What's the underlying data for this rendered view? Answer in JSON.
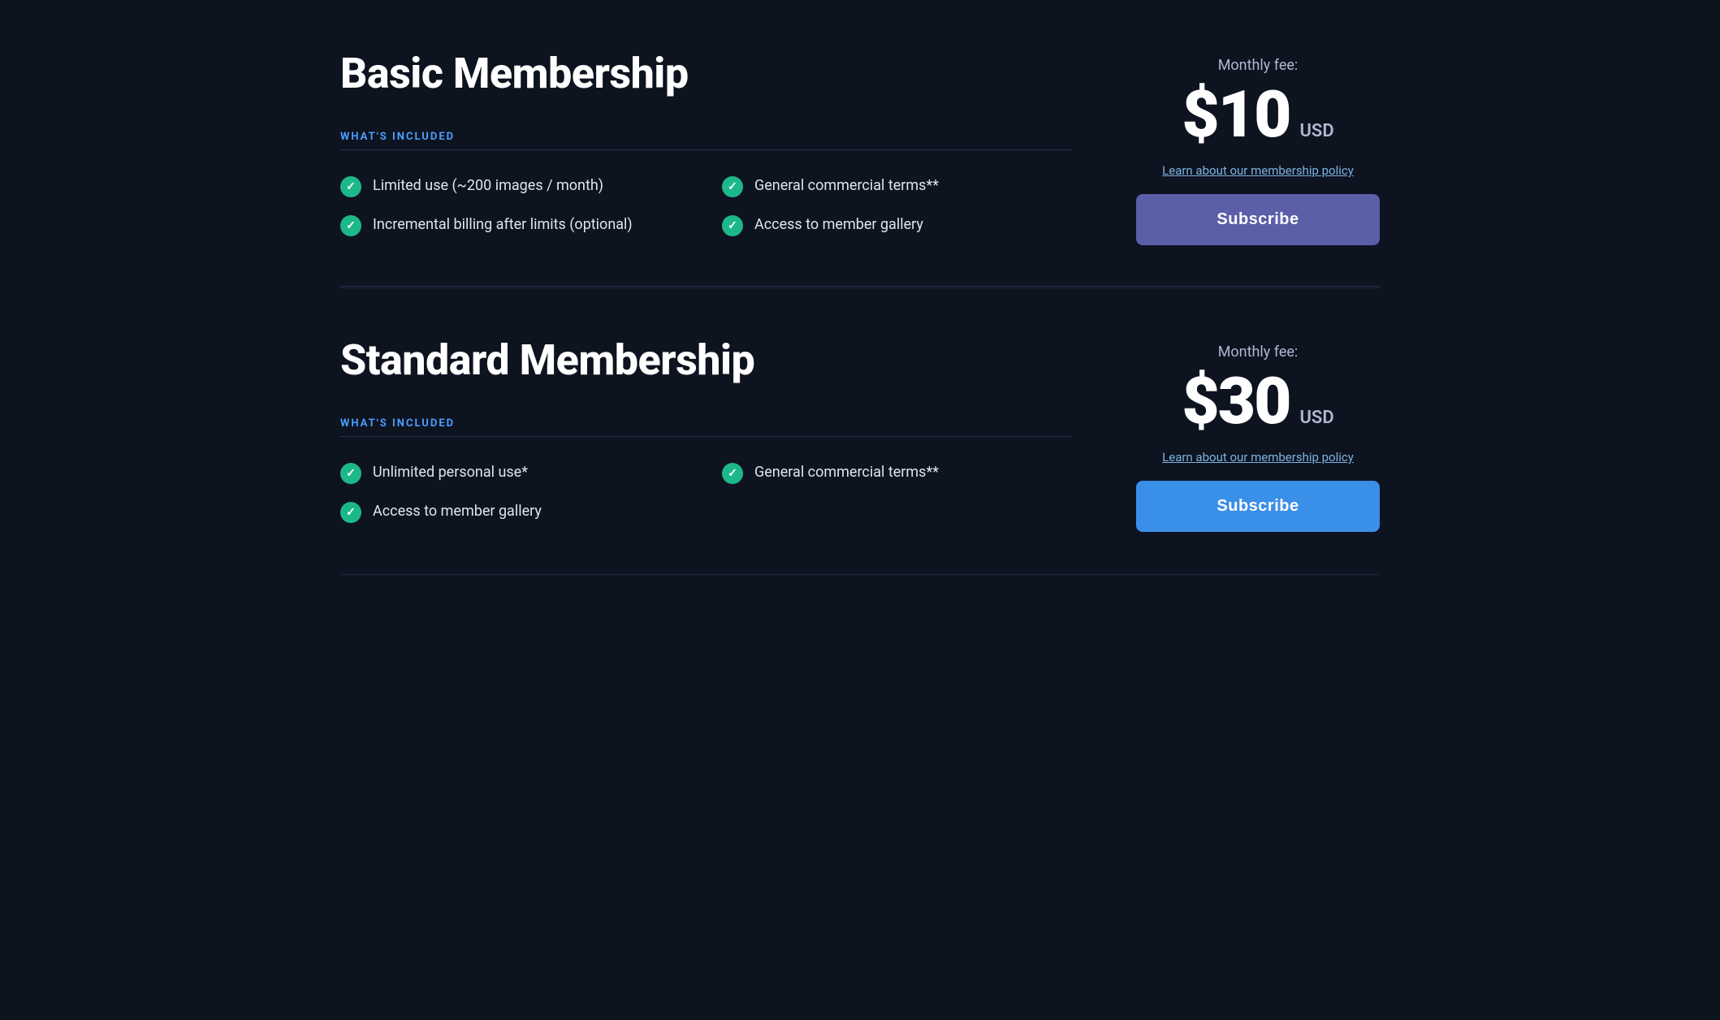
{
  "basic": {
    "title": "Basic Membership",
    "what_included_label": "WHAT'S INCLUDED",
    "features": [
      {
        "text": "Limited use (~200 images / month)"
      },
      {
        "text": "Incremental billing after limits (optional)"
      },
      {
        "text": "General commercial terms**"
      },
      {
        "text": "Access to member gallery"
      }
    ],
    "monthly_fee_label": "Monthly fee:",
    "price": "$10",
    "currency": "USD",
    "policy_link": "Learn about our membership policy",
    "subscribe_label": "Subscribe"
  },
  "standard": {
    "title": "Standard Membership",
    "what_included_label": "WHAT'S INCLUDED",
    "features": [
      {
        "text": "Unlimited personal use*"
      },
      {
        "text": "Access to member gallery"
      },
      {
        "text": "General commercial terms**"
      }
    ],
    "monthly_fee_label": "Monthly fee:",
    "price": "$30",
    "currency": "USD",
    "policy_link": "Learn about our membership policy",
    "subscribe_label": "Subscribe"
  }
}
